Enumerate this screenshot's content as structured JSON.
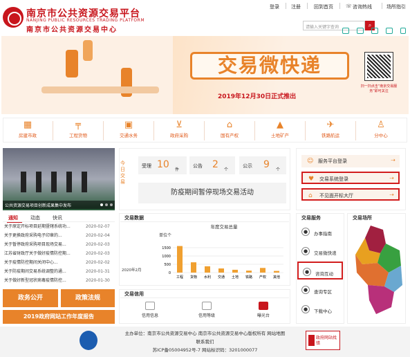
{
  "header": {
    "title_cn": "南京市公共资源交易平台",
    "title_en": "NANJING PUBLIC RESOURCES TRADING PLATFORM",
    "subtitle_cn": "南京市公共资源交易中心",
    "nav": [
      "登录",
      "注册",
      "回到首页",
      "咨询热线",
      "场所指引"
    ],
    "search_placeholder": "请输入关键字查询"
  },
  "banner": {
    "title": "交易微快递",
    "date": "2019年12月30日正式推出",
    "qr_text": "扫一扫点击“南京交易服务”即可关注"
  },
  "categories": [
    {
      "label": "房建市政",
      "icon": "building-icon"
    },
    {
      "label": "工程货物",
      "icon": "crane-icon"
    },
    {
      "label": "交通水务",
      "icon": "bus-icon"
    },
    {
      "label": "政府采购",
      "icon": "cart-icon"
    },
    {
      "label": "国有产权",
      "icon": "bank-icon"
    },
    {
      "label": "土地矿产",
      "icon": "mountain-icon"
    },
    {
      "label": "铁路航运",
      "icon": "plane-icon"
    },
    {
      "label": "分中心",
      "icon": "person-icon"
    }
  ],
  "slide": {
    "caption": "公共资源交易项目创新成果集中发布"
  },
  "trade": {
    "label": "今日交易",
    "stats": [
      {
        "k": "受理",
        "v": "10",
        "u": "件"
      },
      {
        "k": "公告",
        "v": "2",
        "u": "个"
      },
      {
        "k": "公示",
        "v": "9",
        "u": "个"
      }
    ],
    "notice": "防疫期间暂停现场交易活动"
  },
  "right_links": [
    {
      "label": "服务平台登录"
    },
    {
      "label": "交易系统登录"
    },
    {
      "label": "不见面开标大厅"
    }
  ],
  "news": {
    "tabs": [
      "通知",
      "动态",
      "快讯"
    ],
    "items": [
      {
        "title": "关于原定开标项目延期暨辖系统功...",
        "date": "2020-02-07"
      },
      {
        "title": "关于更换政府采购电子印章的...",
        "date": "2020-02-04"
      },
      {
        "title": "关于暂停政府采购项目现场交易...",
        "date": "2020-02-03"
      },
      {
        "title": "江苏省财政厅关于做好疫情防控期...",
        "date": "2020-02-03"
      },
      {
        "title": "关于疫情防控期间关闭中心...",
        "date": "2020-02-02"
      },
      {
        "title": "关于防疫期间交易系统调整的通...",
        "date": "2020-01-31"
      },
      {
        "title": "关于做好新型冠状病毒疫情防控...",
        "date": "2020-01-30"
      }
    ],
    "btn_gov": "政务公开",
    "btn_policy": "政策法规",
    "btn_report": "2019政府网站工作年度报告"
  },
  "stats_section": {
    "title": "交易数据"
  },
  "chart_data": {
    "type": "bar",
    "title": "年度交易总量",
    "ylabel": "单位个",
    "categories": [
      "工程",
      "货物",
      "水利",
      "交通",
      "土地",
      "铁路",
      "产权",
      "其他"
    ],
    "values": [
      1600,
      620,
      380,
      250,
      170,
      120,
      280,
      100
    ],
    "ylim": [
      0,
      2000
    ],
    "yticks": [
      0,
      500,
      1000,
      1500
    ],
    "xlabel_left": "2020年2月"
  },
  "service": {
    "title": "交易服务",
    "items": [
      {
        "label": "办事指南",
        "icon": "guide-icon"
      },
      {
        "label": "交易微快递",
        "icon": "express-icon"
      },
      {
        "label": "咨询互动",
        "icon": "chat-icon"
      },
      {
        "label": "查询专区",
        "icon": "query-icon"
      },
      {
        "label": "下载中心",
        "icon": "download-icon"
      }
    ]
  },
  "places": {
    "title": "交易场所"
  },
  "credit": {
    "title": "交易信用",
    "items": [
      "信用信息",
      "信用等级",
      "曝光台"
    ]
  },
  "footer": {
    "line1": "主办单位：南京市公共资源交易中心    南京市公共资源交易中心版权所有    网站地图",
    "line2": "联系我们",
    "line3": "苏ICP备05004952号-7 网站标识码：3201000077",
    "badge_right": "政府网站找错"
  },
  "colors": {
    "brand": "#c8161d",
    "accent": "#e8832a"
  }
}
